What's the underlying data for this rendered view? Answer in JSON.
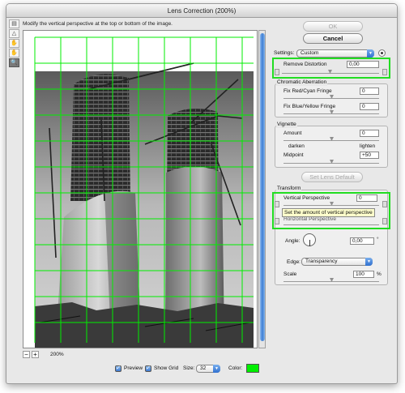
{
  "window": {
    "title": "Lens Correction (200%)"
  },
  "tools": [
    {
      "name": "remove-distortion-tool-icon",
      "glyph": "▤"
    },
    {
      "name": "straighten-tool-icon",
      "glyph": "△"
    },
    {
      "name": "move-grid-tool-icon",
      "glyph": "✋"
    },
    {
      "name": "hand-tool-icon",
      "glyph": "✋"
    },
    {
      "name": "zoom-tool-icon",
      "glyph": "🔍"
    }
  ],
  "hint": "Modify the vertical perspective at the top or bottom of the image.",
  "buttons": {
    "ok": "OK",
    "cancel": "Cancel",
    "set_lens_default": "Set Lens Default"
  },
  "settings": {
    "label": "Settings:",
    "value": "Custom"
  },
  "remove_distortion": {
    "label": "Remove Distortion",
    "value": "0,00"
  },
  "chromatic": {
    "title": "Chromatic Aberration",
    "red_cyan": {
      "label": "Fix Red/Cyan Fringe",
      "value": "0"
    },
    "blue_yellow": {
      "label": "Fix Blue/Yellow Fringe",
      "value": "0"
    }
  },
  "vignette": {
    "title": "Vignette",
    "amount": {
      "label": "Amount",
      "value": "0"
    },
    "darken": "darken",
    "lighten": "lighten",
    "midpoint": {
      "label": "Midpoint",
      "value": "+50"
    }
  },
  "transform": {
    "title": "Transform",
    "vertical": {
      "label": "Vertical Perspective",
      "value": "0"
    },
    "horizontal_label": "Horizontal Perspective",
    "tooltip": "Set the amount of vertical perspective",
    "angle": {
      "label": "Angle:",
      "value": "0,00",
      "unit": "°"
    },
    "edge": {
      "label": "Edge:",
      "value": "Transparency"
    },
    "scale": {
      "label": "Scale",
      "value": "100",
      "unit": "%"
    }
  },
  "zoom": {
    "value": "200%",
    "minus": "−",
    "plus": "+"
  },
  "bottom": {
    "preview": "Preview",
    "show_grid": "Show Grid",
    "size_label": "Size:",
    "size_value": "32",
    "color_label": "Color:",
    "grid_color": "#00ee00"
  },
  "colors": {
    "accent": "#3d7fd5",
    "highlight": "#22dd22"
  }
}
